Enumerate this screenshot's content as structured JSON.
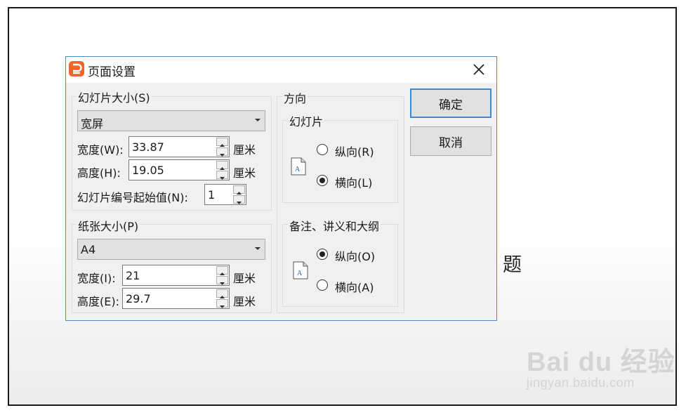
{
  "background": {
    "slide_fragment": "题",
    "watermark": {
      "logo": "Bai du 经验",
      "url": "jingyan.baidu.com"
    }
  },
  "dialog": {
    "title": "页面设置",
    "app_icon_letter": "P",
    "app_icon_color": "#f0652b",
    "slide_size": {
      "group_label": "幻灯片大小(S)",
      "selected": "宽屏",
      "width_label": "宽度(W):",
      "width_value": "33.87",
      "height_label": "高度(H):",
      "height_value": "19.05",
      "unit": "厘米",
      "number_start_label": "幻灯片编号起始值(N):",
      "number_start_value": "1"
    },
    "paper_size": {
      "group_label": "纸张大小(P)",
      "selected": "A4",
      "width_label": "宽度(I):",
      "width_value": "21",
      "height_label": "高度(E):",
      "height_value": "29.7",
      "unit": "厘米"
    },
    "orientation": {
      "group_label": "方向",
      "slides": {
        "label": "幻灯片",
        "portrait": "纵向(R)",
        "landscape": "横向(L)",
        "selected": "landscape"
      },
      "notes": {
        "label": "备注、讲义和大纲",
        "portrait": "纵向(O)",
        "landscape": "横向(A)",
        "selected": "portrait"
      },
      "icon_letter": "A"
    },
    "buttons": {
      "ok": "确定",
      "cancel": "取消"
    },
    "accent_color": "#3c8ad6"
  }
}
